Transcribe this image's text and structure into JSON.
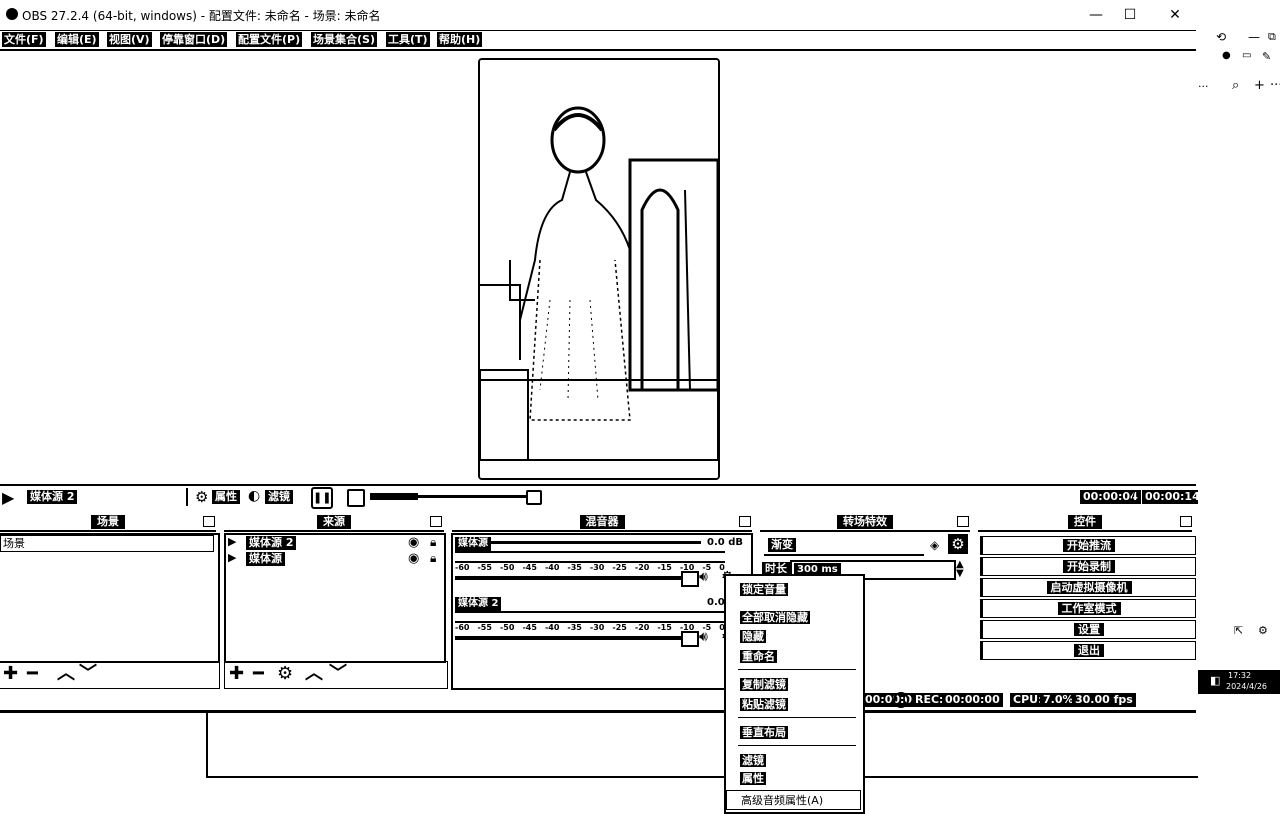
{
  "window": {
    "title": "OBS 27.2.4 (64-bit, windows) - 配置文件: 未命名 - 场景: 未命名",
    "minimize_glyph": "—",
    "maximize_glyph": "☐",
    "close_glyph": "✕"
  },
  "menu": [
    "文件(F)",
    "编辑(E)",
    "视图(V)",
    "停靠窗口(D)",
    "配置文件(P)",
    "场景集合(S)",
    "工具(T)",
    "帮助(H)"
  ],
  "media": {
    "source_name": "媒体源 2",
    "properties_label": "属性",
    "filters_label": "滤镜",
    "current_time": "00:00:04",
    "separator": "/",
    "total_time": "00:00:14",
    "progress": 0.28
  },
  "docks": {
    "scenes": {
      "title": "场景",
      "items": [
        "场景"
      ]
    },
    "sources": {
      "title": "来源",
      "items": [
        "媒体源 2",
        "媒体源"
      ]
    },
    "mixer": {
      "title": "混音器",
      "channels": [
        {
          "name": "媒体源",
          "db": "0.0 dB"
        },
        {
          "name": "媒体源 2",
          "db": "0.0 dB"
        }
      ],
      "scale": [
        "-60",
        "-55",
        "-50",
        "-45",
        "-40",
        "-35",
        "-30",
        "-25",
        "-20",
        "-15",
        "-10",
        "-5",
        "0"
      ]
    },
    "transitions": {
      "title": "转场特效",
      "selected": "渐变",
      "duration_label": "时长",
      "duration_value": "300 ms"
    },
    "controls": {
      "title": "控件",
      "buttons": [
        "开始推流",
        "开始录制",
        "启动虚拟摄像机",
        "工作室模式",
        "设置",
        "退出"
      ]
    }
  },
  "context_menu": {
    "items_group1": [
      "锁定音量",
      "全部取消隐藏",
      "隐藏",
      "重命名"
    ],
    "items_group2": [
      "复制滤镜",
      "粘贴滤镜"
    ],
    "items_group3": [
      "垂直布局"
    ],
    "items_group4": [
      "滤镜",
      "属性",
      "高级音频属性(A)"
    ]
  },
  "status": {
    "live_time": "00:00:00",
    "rec_label": "REC:",
    "rec_time": "00:00:00",
    "cpu_label": "CPU:",
    "cpu_value": "7.0%,",
    "fps": "30.00 fps"
  },
  "taskbar": {
    "time": "17:32",
    "date": "2024/4/26"
  }
}
